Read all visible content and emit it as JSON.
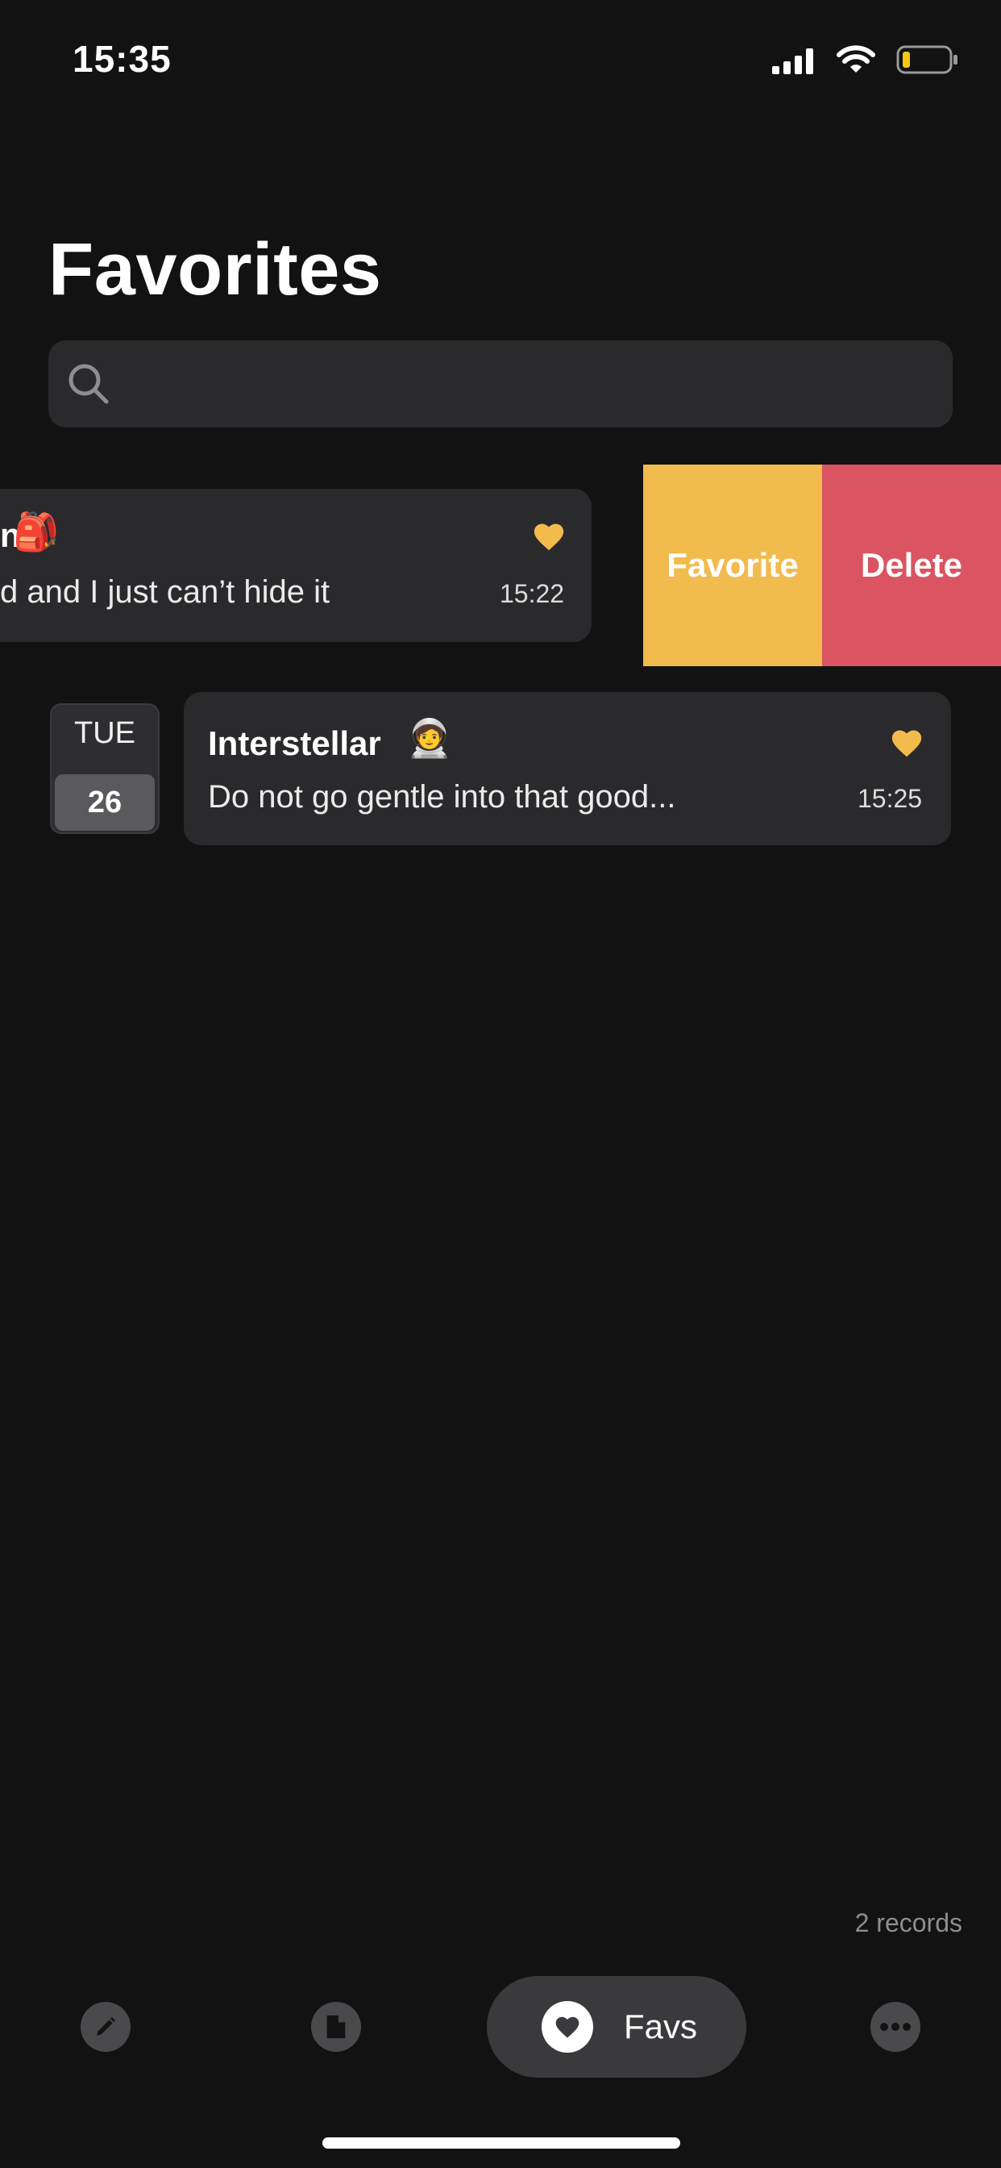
{
  "status_bar": {
    "time": "15:35"
  },
  "page_title": "Favorites",
  "search": {
    "value": "",
    "placeholder": ""
  },
  "entries": [
    {
      "title_visible": "n",
      "emoji": "🎒",
      "preview": "d and I just can’t hide it",
      "time": "15:22",
      "favorite": true
    },
    {
      "day": "TUE",
      "date": "26",
      "title": "Interstellar",
      "emoji": "🧑‍🚀",
      "preview": "Do not go gentle into that good...",
      "time": "15:25",
      "favorite": true
    }
  ],
  "swipe_actions": {
    "favorite": "Favorite",
    "delete": "Delete"
  },
  "records_count": "2 records",
  "tab_bar": {
    "items": [
      {
        "icon": "pencil-icon"
      },
      {
        "icon": "document-icon"
      },
      {
        "icon": "heart-icon",
        "label": "Favs",
        "selected": true
      },
      {
        "icon": "more-icon"
      }
    ]
  },
  "colors": {
    "background": "#121212",
    "card": "#2a2a2c",
    "accent_favorite": "#f2bb4e",
    "destructive": "#da5462"
  }
}
